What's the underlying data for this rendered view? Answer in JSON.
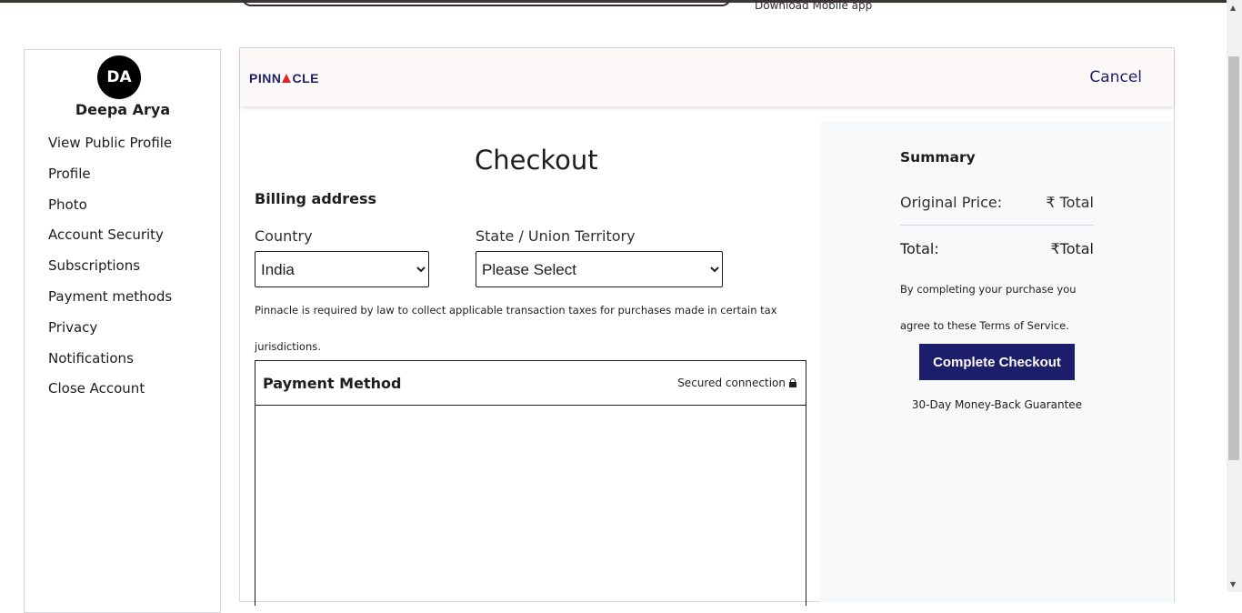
{
  "topbar": {
    "app_link": "Download Mobile app"
  },
  "user": {
    "initials": "DA",
    "name": "Deepa Arya"
  },
  "sidebar": {
    "items": [
      {
        "label": "View Public Profile"
      },
      {
        "label": "Profile"
      },
      {
        "label": "Photo"
      },
      {
        "label": "Account Security"
      },
      {
        "label": "Subscriptions"
      },
      {
        "label": "Payment methods"
      },
      {
        "label": "Privacy"
      },
      {
        "label": "Notifications"
      },
      {
        "label": "Close Account"
      }
    ]
  },
  "header": {
    "logo_left": "PINN",
    "logo_right": "CLE",
    "cancel_label": "Cancel"
  },
  "checkout": {
    "title": "Checkout",
    "billing_title": "Billing address",
    "country_label": "Country",
    "country_value": "India",
    "state_label": "State / Union Territory",
    "state_value": "Please Select",
    "tax_note": "Pinnacle is required by law to collect applicable transaction taxes for purchases made in certain tax jurisdictions."
  },
  "payment": {
    "title": "Payment Method",
    "secured_label": "Secured connection"
  },
  "summary": {
    "title": "Summary",
    "original_price_label": "Original Price:",
    "original_price_value": "₹ Total",
    "total_label": "Total:",
    "total_value": "₹Total",
    "terms": "By completing your purchase you agree to these Terms of Service.",
    "complete_button": "Complete Checkout",
    "guarantee": "30-Day Money-Back Guarantee"
  },
  "colors": {
    "brand_navy": "#1c1d6b",
    "brand_red": "#e0252a",
    "summary_bg": "#f7f9fa",
    "header_bg": "#fcf9f8"
  }
}
